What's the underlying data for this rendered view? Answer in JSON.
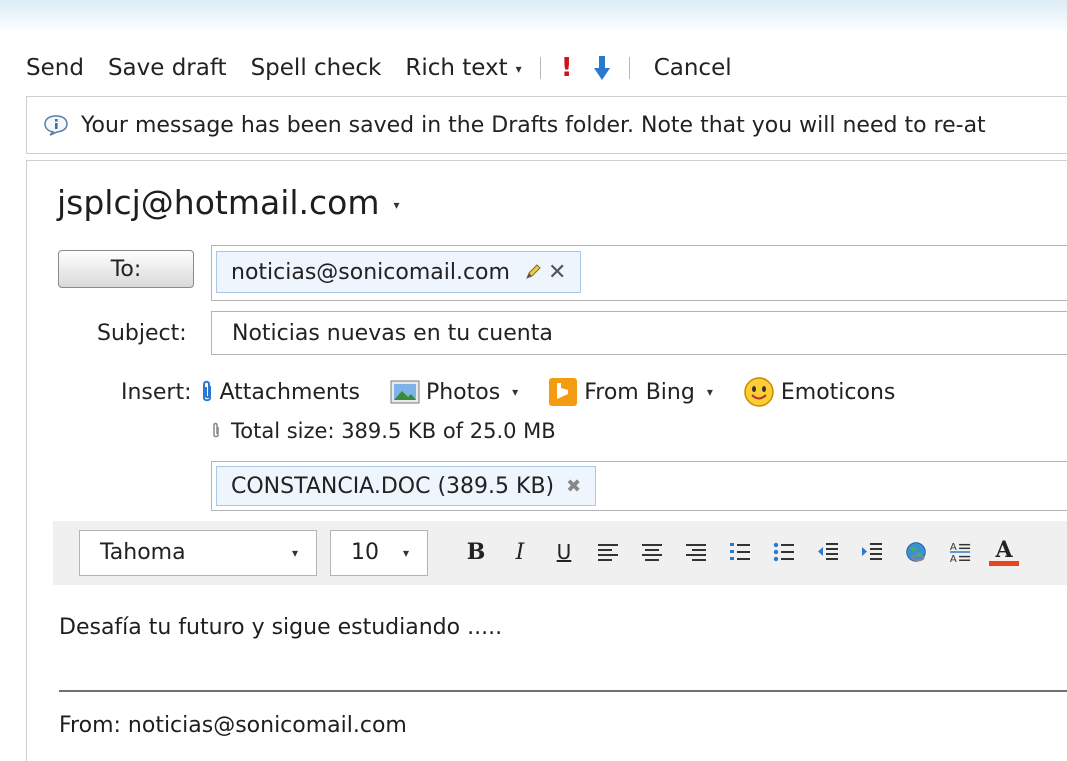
{
  "toolbar": {
    "send": "Send",
    "save_draft": "Save draft",
    "spell_check": "Spell check",
    "rich_text": "Rich text",
    "cancel": "Cancel",
    "caret": "▾"
  },
  "infobar": {
    "message": "Your message has been saved in the Drafts folder. Note that you will need to re-at"
  },
  "compose": {
    "from_address": "jsplcj@hotmail.com",
    "to_button": "To:",
    "to_recipient": "noticias@sonicomail.com",
    "subject_label": "Subject:",
    "subject_value": "Noticias nuevas en tu cuenta",
    "insert_label": "Insert:",
    "insert_items": {
      "attachments": "Attachments",
      "photos": "Photos",
      "from_bing": "From Bing",
      "emoticons": "Emoticons"
    },
    "total_size": "Total size: 389.5 KB of 25.0 MB",
    "attachment_name": "CONSTANCIA.DOC (389.5 KB)"
  },
  "format": {
    "font": "Tahoma",
    "size": "10",
    "bold": "B",
    "italic": "I",
    "underline": "U",
    "font_color": "A",
    "font_color_hex": "#e8461a"
  },
  "body": {
    "text": "Desafía tu futuro y sigue estudiando .....",
    "quoted_from": "From: noticias@sonicomail.com"
  },
  "colors": {
    "importance_high": "#d0101a",
    "importance_low": "#2a78d0",
    "chip_bg": "#eef5fd",
    "chip_border": "#a7c7ec"
  }
}
